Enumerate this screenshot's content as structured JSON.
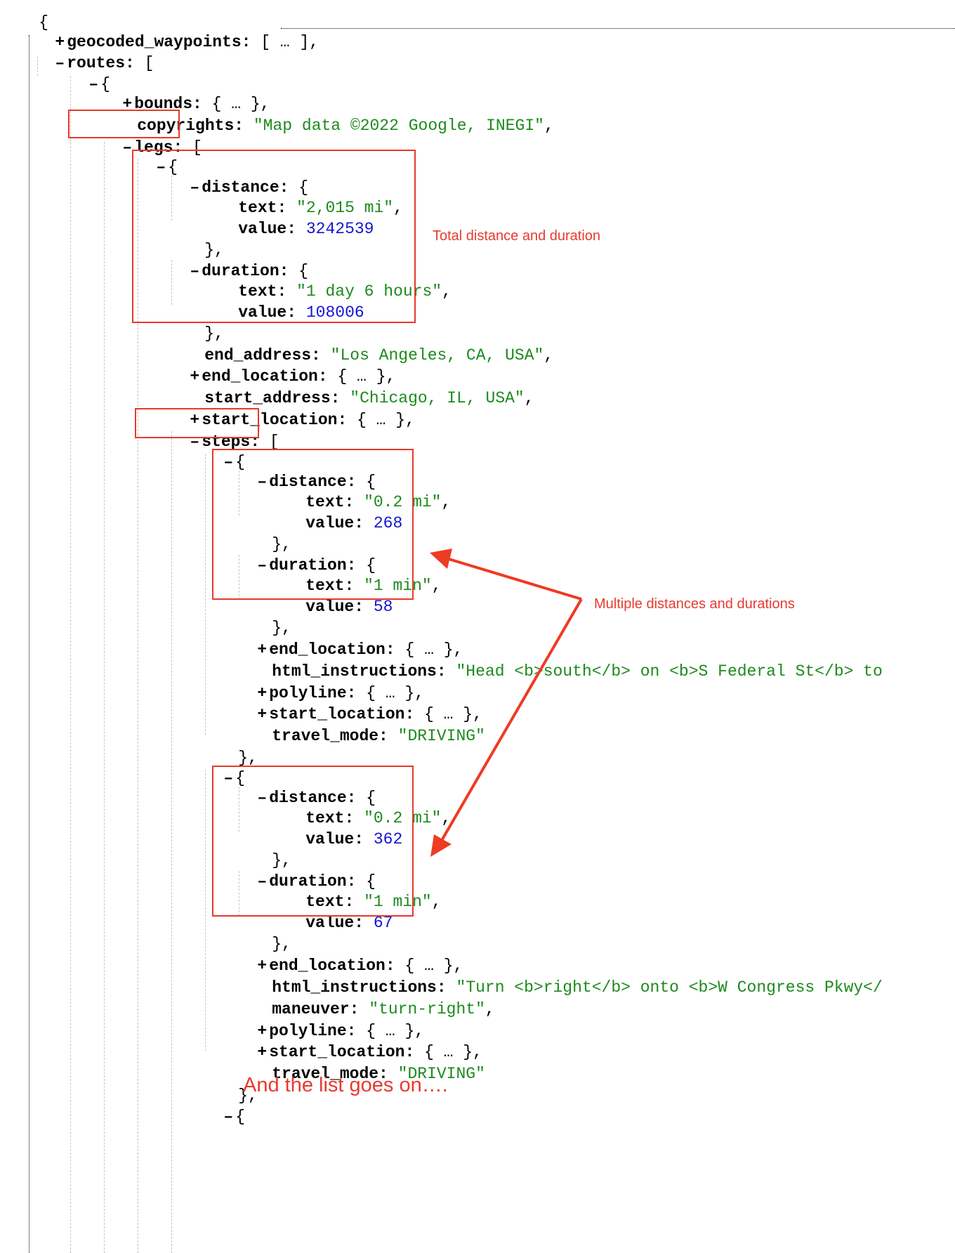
{
  "viewer": {
    "opening_brace": "{",
    "root": {
      "geocoded_waypoints_key": "geocoded_waypoints",
      "routes_key": "routes"
    },
    "route": {
      "bounds_key": "bounds",
      "copyrights_key": "copyrights",
      "copyrights_value": "\"Map data ©2022 Google, INEGI\"",
      "legs_key": "legs"
    },
    "leg": {
      "distance_key": "distance",
      "distance_text": "\"2,015 mi\"",
      "distance_value": "3242539",
      "duration_key": "duration",
      "duration_text": "\"1 day 6 hours\"",
      "duration_value": "108006",
      "end_address_key": "end_address",
      "end_address_value": "\"Los Angeles, CA, USA\"",
      "end_location_key": "end_location",
      "start_address_key": "start_address",
      "start_address_value": "\"Chicago, IL, USA\"",
      "start_location_key": "start_location",
      "steps_key": "steps"
    },
    "steps": [
      {
        "distance_text": "\"0.2 mi\"",
        "distance_value": "268",
        "duration_text": "\"1 min\"",
        "duration_value": "58",
        "html_instructions": "\"Head <b>south</b> on <b>S Federal St</b> to",
        "travel_mode": "\"DRIVING\""
      },
      {
        "distance_text": "\"0.2 mi\"",
        "distance_value": "362",
        "duration_text": "\"1 min\"",
        "duration_value": "67",
        "html_instructions": "\"Turn <b>right</b> onto <b>W Congress Pkwy</",
        "maneuver": "\"turn-right\"",
        "travel_mode": "\"DRIVING\""
      }
    ],
    "keys": {
      "text": "text",
      "value": "value",
      "distance": "distance",
      "duration": "duration",
      "end_location": "end_location",
      "html_instructions": "html_instructions",
      "maneuver": "maneuver",
      "polyline": "polyline",
      "start_location": "start_location",
      "travel_mode": "travel_mode"
    },
    "symbols": {
      "expand": "+",
      "collapse": "–",
      "collapsed_array": "[ … ],",
      "collapsed_object": "{ … },",
      "open_array": "[",
      "open_object": "{",
      "close_object": "},",
      "close_object_last": "}",
      "colon": ":",
      "comma": ","
    }
  },
  "annotations": {
    "total_label": "Total distance and duration",
    "multiple_label": "Multiple distances and durations",
    "more_label": "And the list goes on…."
  },
  "colors": {
    "string": "#1c8a1c",
    "number": "#1414d2",
    "highlight": "#e6392c",
    "annotation": "#e83a2f",
    "guide": "#c4c4c4"
  }
}
